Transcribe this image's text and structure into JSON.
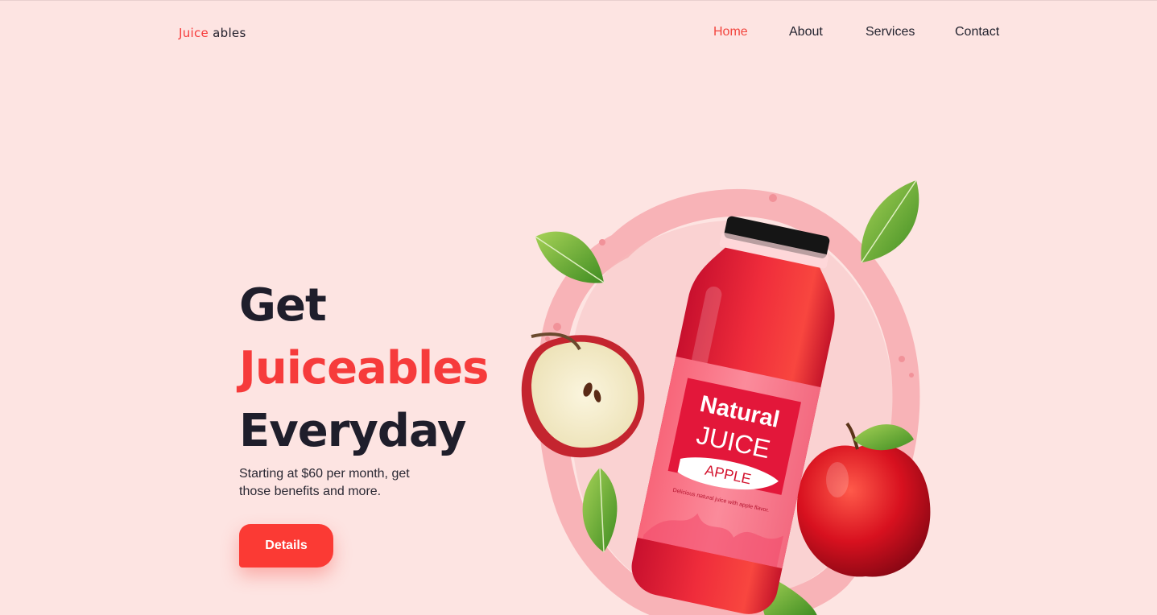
{
  "logo": {
    "part1": "Juice",
    "part2": " ables"
  },
  "nav": [
    {
      "label": "Home",
      "active": true
    },
    {
      "label": "About",
      "active": false
    },
    {
      "label": "Services",
      "active": false
    },
    {
      "label": "Contact",
      "active": false
    }
  ],
  "hero": {
    "line1": "Get",
    "line2": "Juiceables",
    "line3": "Everyday",
    "subtitle": "Starting at $60 per month, get those benefits and more.",
    "button_label": "Details"
  },
  "product": {
    "label_top": "Natural",
    "label_main": "JUICE",
    "flavor": "APPLE",
    "tagline": "Delicious natural juice with apple flavor."
  },
  "colors": {
    "background": "#fde4e2",
    "accent": "#f63b3b",
    "text_dark": "#1f1e2b",
    "button": "#fb3a34"
  }
}
